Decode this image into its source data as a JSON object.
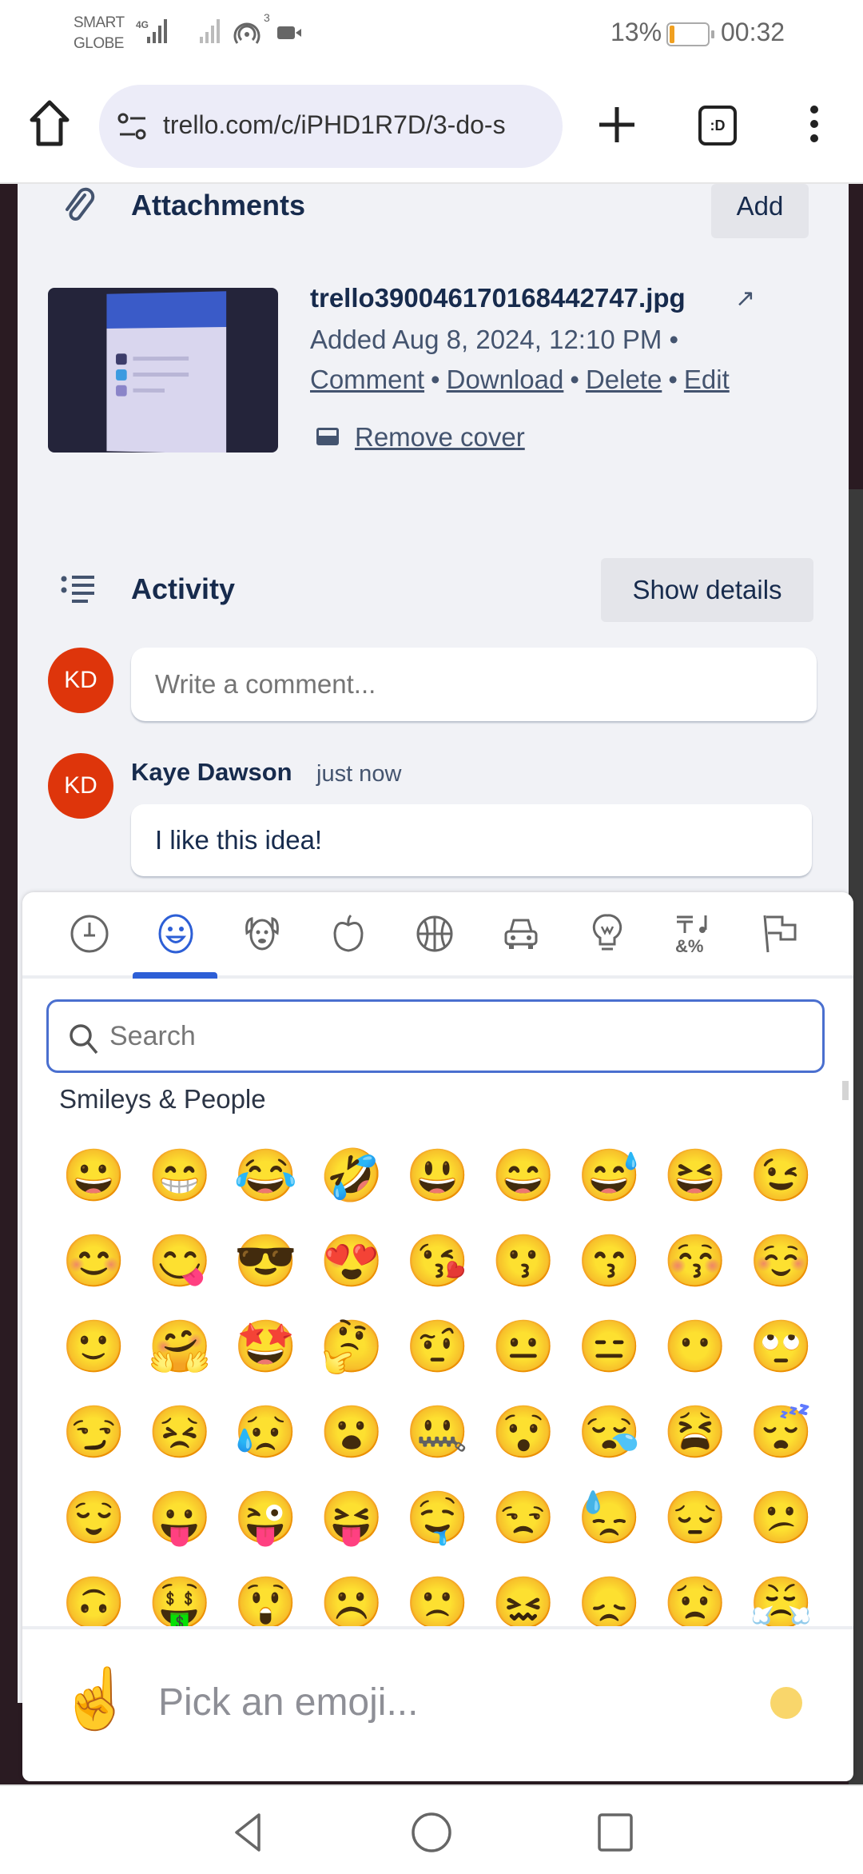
{
  "status_bar": {
    "carrier_1": "SMART",
    "carrier_2": "GLOBE",
    "network": "4G",
    "hotspot_count": "3",
    "battery_percent": "13%",
    "battery_level": 0.13,
    "time": "00:32"
  },
  "browser": {
    "url": "trello.com/c/iPHD1R7D/3-do-s",
    "tabs_label": ":D"
  },
  "attachments": {
    "title": "Attachments",
    "add_label": "Add",
    "file": {
      "name": "trello390046170168442747.jpg",
      "open_icon": "↗",
      "added": "Added Aug 8, 2024, 12:10 PM •",
      "actions": [
        "Comment",
        "Download",
        "Delete",
        "Edit"
      ],
      "separator": "•",
      "remove_cover": "Remove cover"
    }
  },
  "activity": {
    "title": "Activity",
    "show_details_label": "Show details",
    "avatar_initials": "KD",
    "comment_placeholder": "Write a comment...",
    "comments": [
      {
        "author": "Kaye Dawson",
        "time": "just now",
        "initials": "KD",
        "text": "I like this idea!"
      }
    ]
  },
  "emoji_picker": {
    "categories": [
      {
        "name": "frequently-used",
        "icon": "clock-icon",
        "active": false
      },
      {
        "name": "smileys-people",
        "icon": "smiley-icon",
        "active": true
      },
      {
        "name": "animals-nature",
        "icon": "dog-icon",
        "active": false
      },
      {
        "name": "food-drink",
        "icon": "apple-icon",
        "active": false
      },
      {
        "name": "activity",
        "icon": "basketball-icon",
        "active": false
      },
      {
        "name": "travel-places",
        "icon": "car-icon",
        "active": false
      },
      {
        "name": "objects",
        "icon": "lightbulb-icon",
        "active": false
      },
      {
        "name": "symbols",
        "icon": "symbols-icon",
        "active": false
      },
      {
        "name": "flags",
        "icon": "flag-icon",
        "active": false
      }
    ],
    "search_placeholder": "Search",
    "section_title": "Smileys & People",
    "emojis": [
      "😀",
      "😁",
      "😂",
      "🤣",
      "😃",
      "😄",
      "😅",
      "😆",
      "😉",
      "😊",
      "😋",
      "😎",
      "😍",
      "😘",
      "😗",
      "😙",
      "😚",
      "☺️",
      "🙂",
      "🤗",
      "🤩",
      "🤔",
      "🤨",
      "😐",
      "😑",
      "😶",
      "🙄",
      "😏",
      "😣",
      "😥",
      "😮",
      "🤐",
      "😯",
      "😪",
      "😫",
      "😴",
      "😌",
      "😛",
      "😜",
      "😝",
      "🤤",
      "😒",
      "😓",
      "😔",
      "😕",
      "🙃",
      "🤑",
      "😲",
      "☹️",
      "🙁",
      "😖",
      "😞",
      "😟",
      "😤"
    ],
    "preview_emoji": "☝️",
    "preview_text": "Pick an emoji...",
    "accent_color": "#2d5fd6"
  },
  "colors": {
    "avatar": "#de350b",
    "panel_bg": "#f1f2f6",
    "text_primary": "#172b4d",
    "text_secondary": "#44546f"
  }
}
